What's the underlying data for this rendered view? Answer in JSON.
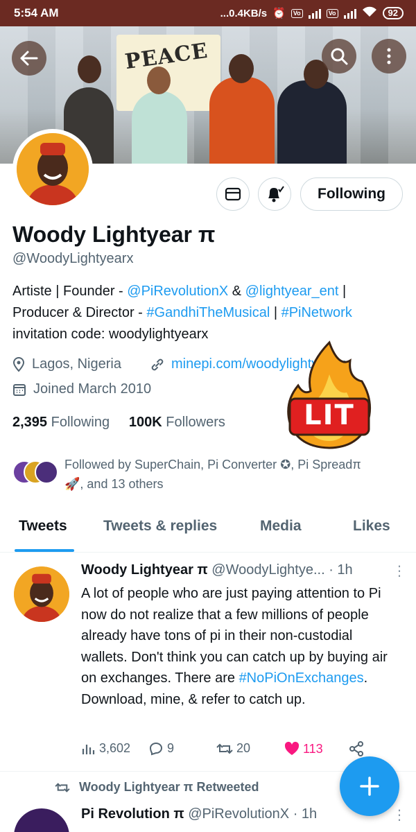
{
  "status_bar": {
    "time": "5:54 AM",
    "network_speed": "...0.4KB/s",
    "battery": "92"
  },
  "profile": {
    "name": "Woody Lightyear π",
    "handle": "@WoodyLightyearx",
    "bio_line1_prefix": "Artiste | Founder - ",
    "bio_mention1": "@PiRevolutionX",
    "bio_amp": " & ",
    "bio_mention2": "@lightyear_ent",
    "bio_line1_suffix": " |",
    "bio_line2_prefix": "Producer & Director - ",
    "bio_tag1": "#GandhiTheMusical",
    "bio_sep": " | ",
    "bio_tag2": "#PiNetwork",
    "bio_line3": "invitation code: woodylightyearx",
    "location": "Lagos, Nigeria",
    "website": "minepi.com/woodylightyearx",
    "joined": "Joined March 2010",
    "following_count": "2,395",
    "following_label": "Following",
    "followers_count": "100K",
    "followers_label": "Followers",
    "following_button": "Following",
    "followed_by_line1": "Followed by SuperChain, Pi Converter ✪, Pi Spreadπ",
    "followed_by_line2": ", and 13 others"
  },
  "banner": {
    "poster_text": "PEACE"
  },
  "sticker": {
    "text": "LIT"
  },
  "tabs": [
    {
      "label": "Tweets",
      "active": true
    },
    {
      "label": "Tweets & replies",
      "active": false
    },
    {
      "label": "Media",
      "active": false
    },
    {
      "label": "Likes",
      "active": false
    }
  ],
  "tweet": {
    "author": "Woody Lightyear π",
    "handle": "@WoodyLightye...",
    "time": "· 1h",
    "text_before": "A lot of people who are just paying attention to Pi now do not realize that a few millions of people already have tons of pi in their non-custodial wallets. Don't think you can catch up by buying air on exchanges. There are ",
    "hashtag": "#NoPiOnExchanges",
    "text_after": ". Download, mine, & refer to catch up.",
    "views": "3,602",
    "replies": "9",
    "retweets": "20",
    "likes": "113"
  },
  "retweet_notice": "Woody Lightyear π Retweeted",
  "tweet2": {
    "author": "Pi Revolution π",
    "handle": "@PiRevolutionX",
    "time": "· 1h"
  },
  "colors": {
    "accent": "#1d9bf0",
    "like": "#f91880",
    "status_bar": "#6b2a22"
  }
}
